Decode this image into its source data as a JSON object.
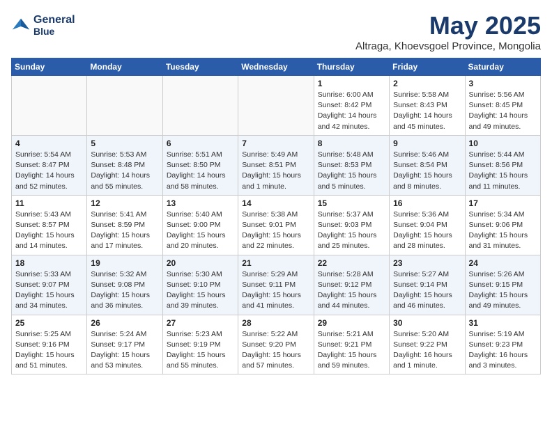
{
  "logo": {
    "line1": "General",
    "line2": "Blue"
  },
  "title": "May 2025",
  "subtitle": "Altraga, Khoevsgoel Province, Mongolia",
  "headers": [
    "Sunday",
    "Monday",
    "Tuesday",
    "Wednesday",
    "Thursday",
    "Friday",
    "Saturday"
  ],
  "weeks": [
    [
      {
        "day": "",
        "info": ""
      },
      {
        "day": "",
        "info": ""
      },
      {
        "day": "",
        "info": ""
      },
      {
        "day": "",
        "info": ""
      },
      {
        "day": "1",
        "info": "Sunrise: 6:00 AM\nSunset: 8:42 PM\nDaylight: 14 hours\nand 42 minutes."
      },
      {
        "day": "2",
        "info": "Sunrise: 5:58 AM\nSunset: 8:43 PM\nDaylight: 14 hours\nand 45 minutes."
      },
      {
        "day": "3",
        "info": "Sunrise: 5:56 AM\nSunset: 8:45 PM\nDaylight: 14 hours\nand 49 minutes."
      }
    ],
    [
      {
        "day": "4",
        "info": "Sunrise: 5:54 AM\nSunset: 8:47 PM\nDaylight: 14 hours\nand 52 minutes."
      },
      {
        "day": "5",
        "info": "Sunrise: 5:53 AM\nSunset: 8:48 PM\nDaylight: 14 hours\nand 55 minutes."
      },
      {
        "day": "6",
        "info": "Sunrise: 5:51 AM\nSunset: 8:50 PM\nDaylight: 14 hours\nand 58 minutes."
      },
      {
        "day": "7",
        "info": "Sunrise: 5:49 AM\nSunset: 8:51 PM\nDaylight: 15 hours\nand 1 minute."
      },
      {
        "day": "8",
        "info": "Sunrise: 5:48 AM\nSunset: 8:53 PM\nDaylight: 15 hours\nand 5 minutes."
      },
      {
        "day": "9",
        "info": "Sunrise: 5:46 AM\nSunset: 8:54 PM\nDaylight: 15 hours\nand 8 minutes."
      },
      {
        "day": "10",
        "info": "Sunrise: 5:44 AM\nSunset: 8:56 PM\nDaylight: 15 hours\nand 11 minutes."
      }
    ],
    [
      {
        "day": "11",
        "info": "Sunrise: 5:43 AM\nSunset: 8:57 PM\nDaylight: 15 hours\nand 14 minutes."
      },
      {
        "day": "12",
        "info": "Sunrise: 5:41 AM\nSunset: 8:59 PM\nDaylight: 15 hours\nand 17 minutes."
      },
      {
        "day": "13",
        "info": "Sunrise: 5:40 AM\nSunset: 9:00 PM\nDaylight: 15 hours\nand 20 minutes."
      },
      {
        "day": "14",
        "info": "Sunrise: 5:38 AM\nSunset: 9:01 PM\nDaylight: 15 hours\nand 22 minutes."
      },
      {
        "day": "15",
        "info": "Sunrise: 5:37 AM\nSunset: 9:03 PM\nDaylight: 15 hours\nand 25 minutes."
      },
      {
        "day": "16",
        "info": "Sunrise: 5:36 AM\nSunset: 9:04 PM\nDaylight: 15 hours\nand 28 minutes."
      },
      {
        "day": "17",
        "info": "Sunrise: 5:34 AM\nSunset: 9:06 PM\nDaylight: 15 hours\nand 31 minutes."
      }
    ],
    [
      {
        "day": "18",
        "info": "Sunrise: 5:33 AM\nSunset: 9:07 PM\nDaylight: 15 hours\nand 34 minutes."
      },
      {
        "day": "19",
        "info": "Sunrise: 5:32 AM\nSunset: 9:08 PM\nDaylight: 15 hours\nand 36 minutes."
      },
      {
        "day": "20",
        "info": "Sunrise: 5:30 AM\nSunset: 9:10 PM\nDaylight: 15 hours\nand 39 minutes."
      },
      {
        "day": "21",
        "info": "Sunrise: 5:29 AM\nSunset: 9:11 PM\nDaylight: 15 hours\nand 41 minutes."
      },
      {
        "day": "22",
        "info": "Sunrise: 5:28 AM\nSunset: 9:12 PM\nDaylight: 15 hours\nand 44 minutes."
      },
      {
        "day": "23",
        "info": "Sunrise: 5:27 AM\nSunset: 9:14 PM\nDaylight: 15 hours\nand 46 minutes."
      },
      {
        "day": "24",
        "info": "Sunrise: 5:26 AM\nSunset: 9:15 PM\nDaylight: 15 hours\nand 49 minutes."
      }
    ],
    [
      {
        "day": "25",
        "info": "Sunrise: 5:25 AM\nSunset: 9:16 PM\nDaylight: 15 hours\nand 51 minutes."
      },
      {
        "day": "26",
        "info": "Sunrise: 5:24 AM\nSunset: 9:17 PM\nDaylight: 15 hours\nand 53 minutes."
      },
      {
        "day": "27",
        "info": "Sunrise: 5:23 AM\nSunset: 9:19 PM\nDaylight: 15 hours\nand 55 minutes."
      },
      {
        "day": "28",
        "info": "Sunrise: 5:22 AM\nSunset: 9:20 PM\nDaylight: 15 hours\nand 57 minutes."
      },
      {
        "day": "29",
        "info": "Sunrise: 5:21 AM\nSunset: 9:21 PM\nDaylight: 15 hours\nand 59 minutes."
      },
      {
        "day": "30",
        "info": "Sunrise: 5:20 AM\nSunset: 9:22 PM\nDaylight: 16 hours\nand 1 minute."
      },
      {
        "day": "31",
        "info": "Sunrise: 5:19 AM\nSunset: 9:23 PM\nDaylight: 16 hours\nand 3 minutes."
      }
    ]
  ]
}
